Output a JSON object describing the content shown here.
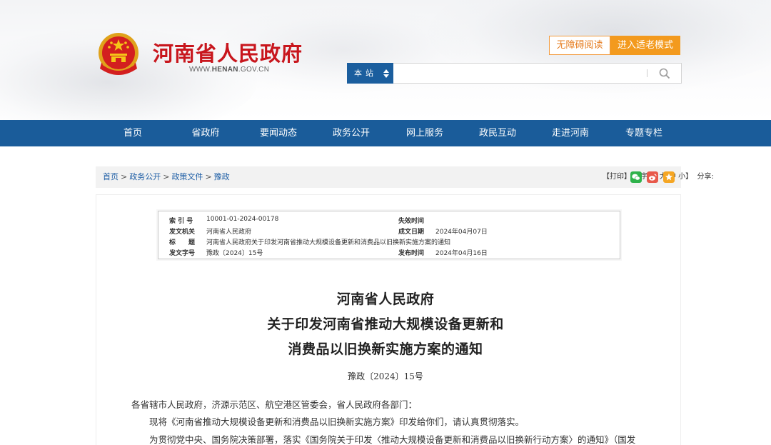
{
  "header": {
    "site_name": "河南省人民政府",
    "domain_prefix": "WWW.",
    "domain_main": "HENAN",
    "domain_suffix": ".GOV.CN",
    "accessibility_label": "无障碍阅读",
    "elder_mode_label": "进入适老模式",
    "search": {
      "scope_label": "本站",
      "value": "",
      "placeholder": ""
    }
  },
  "nav": {
    "items": [
      "首页",
      "省政府",
      "要闻动态",
      "政务公开",
      "网上服务",
      "政民互动",
      "走进河南",
      "专题专栏"
    ]
  },
  "breadcrumb": {
    "items": [
      "首页",
      "政务公开",
      "政策文件",
      "豫政"
    ],
    "separator": ">"
  },
  "tools": {
    "print": "【打印】",
    "font_label": "【字体:",
    "font_large": "大",
    "font_medium": "中",
    "font_small": "小",
    "font_close": "】",
    "share_label": "分享:"
  },
  "colors": {
    "nav_bg": "#1a5c9a",
    "brand_red": "#c8161d",
    "orange": "#f39a1e",
    "link": "#1f5fa6"
  },
  "metadata": {
    "index_no_label": "索 引 号",
    "index_no": "10001-01-2024-00178",
    "expiry_label": "失效时间",
    "expiry": "",
    "issuer_label": "发文机关",
    "issuer": "河南省人民政府",
    "date_written_label": "成文日期",
    "date_written": "2024年04月07日",
    "title_label": "标　　题",
    "title": "河南省人民政府关于印发河南省推动大规模设备更新和消费品以旧换新实施方案的通知",
    "doc_no_label": "发文字号",
    "doc_no": "豫政〔2024〕15号",
    "publish_label": "发布时间",
    "publish": "2024年04月16日"
  },
  "document": {
    "title_line1": "河南省人民政府",
    "title_line2": "关于印发河南省推动大规模设备更新和",
    "title_line3": "消费品以旧换新实施方案的通知",
    "number": "豫政〔2024〕15号",
    "salutation": "各省辖市人民政府，济源示范区、航空港区管委会，省人民政府各部门：",
    "para1": "现将《河南省推动大规模设备更新和消费品以旧换新实施方案》印发给你们，请认真贯彻落实。",
    "para2": "为贯彻党中央、国务院决策部署，落实《国务院关于印发〈推动大规模设备更新和消费品以旧换新行动方案〉的通知》（国发"
  }
}
